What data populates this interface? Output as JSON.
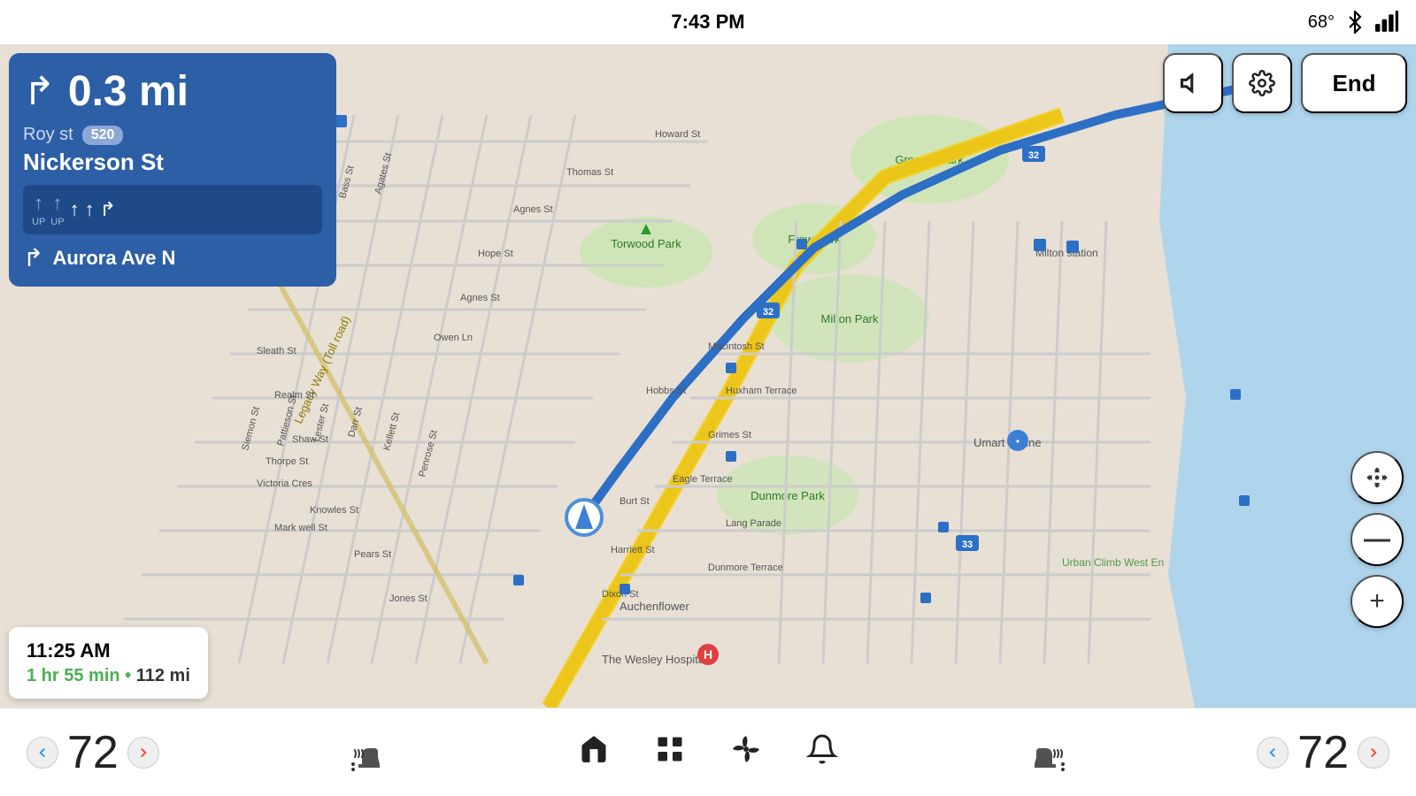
{
  "statusBar": {
    "time": "7:43 PM",
    "temperature": "68°",
    "bluetoothIcon": "bluetooth",
    "signalIcon": "signal"
  },
  "navCard": {
    "distance": "0.3 mi",
    "streetSmall": "Roy st",
    "routeBadge": "520",
    "streetMain": "Nickerson St",
    "lanes": [
      {
        "label": "UP",
        "arrow": "↑",
        "active": false
      },
      {
        "label": "UP",
        "arrow": "↑",
        "active": false
      },
      {
        "label": "",
        "arrow": "↑",
        "active": true
      },
      {
        "label": "",
        "arrow": "↑",
        "active": true
      },
      {
        "label": "",
        "arrow": "↱",
        "active": true
      }
    ],
    "nextStreet": "Aurora Ave N"
  },
  "etaCard": {
    "arrivalTime": "11:25 AM",
    "duration": "1 hr 55 min",
    "distance": "112 mi"
  },
  "controls": {
    "muteLabel": "mute",
    "settingsLabel": "settings",
    "endLabel": "End"
  },
  "bottomBar": {
    "leftTemp": "72",
    "rightTemp": "72",
    "leftArrow": "<",
    "rightArrow": ">",
    "leftRightArrow": ">",
    "homeIcon": "home",
    "gridIcon": "grid",
    "fanIcon": "fan",
    "bellIcon": "bell",
    "heatSeatLeft": "heat-seat",
    "heatSeatRight": "heat-seat"
  },
  "map": {
    "locationLabel": "You are here",
    "parkLabels": [
      "Gregory Park",
      "Frew Park",
      "Torwood Park",
      "Milton Park",
      "Dunmore Park"
    ],
    "placeLabels": [
      "Milton station",
      "Umart Online",
      "Auchenflower",
      "The Wesley Hospital",
      "Urban Climb West En"
    ],
    "roadLabels": [
      "Legacy Way (Toll road)"
    ]
  }
}
